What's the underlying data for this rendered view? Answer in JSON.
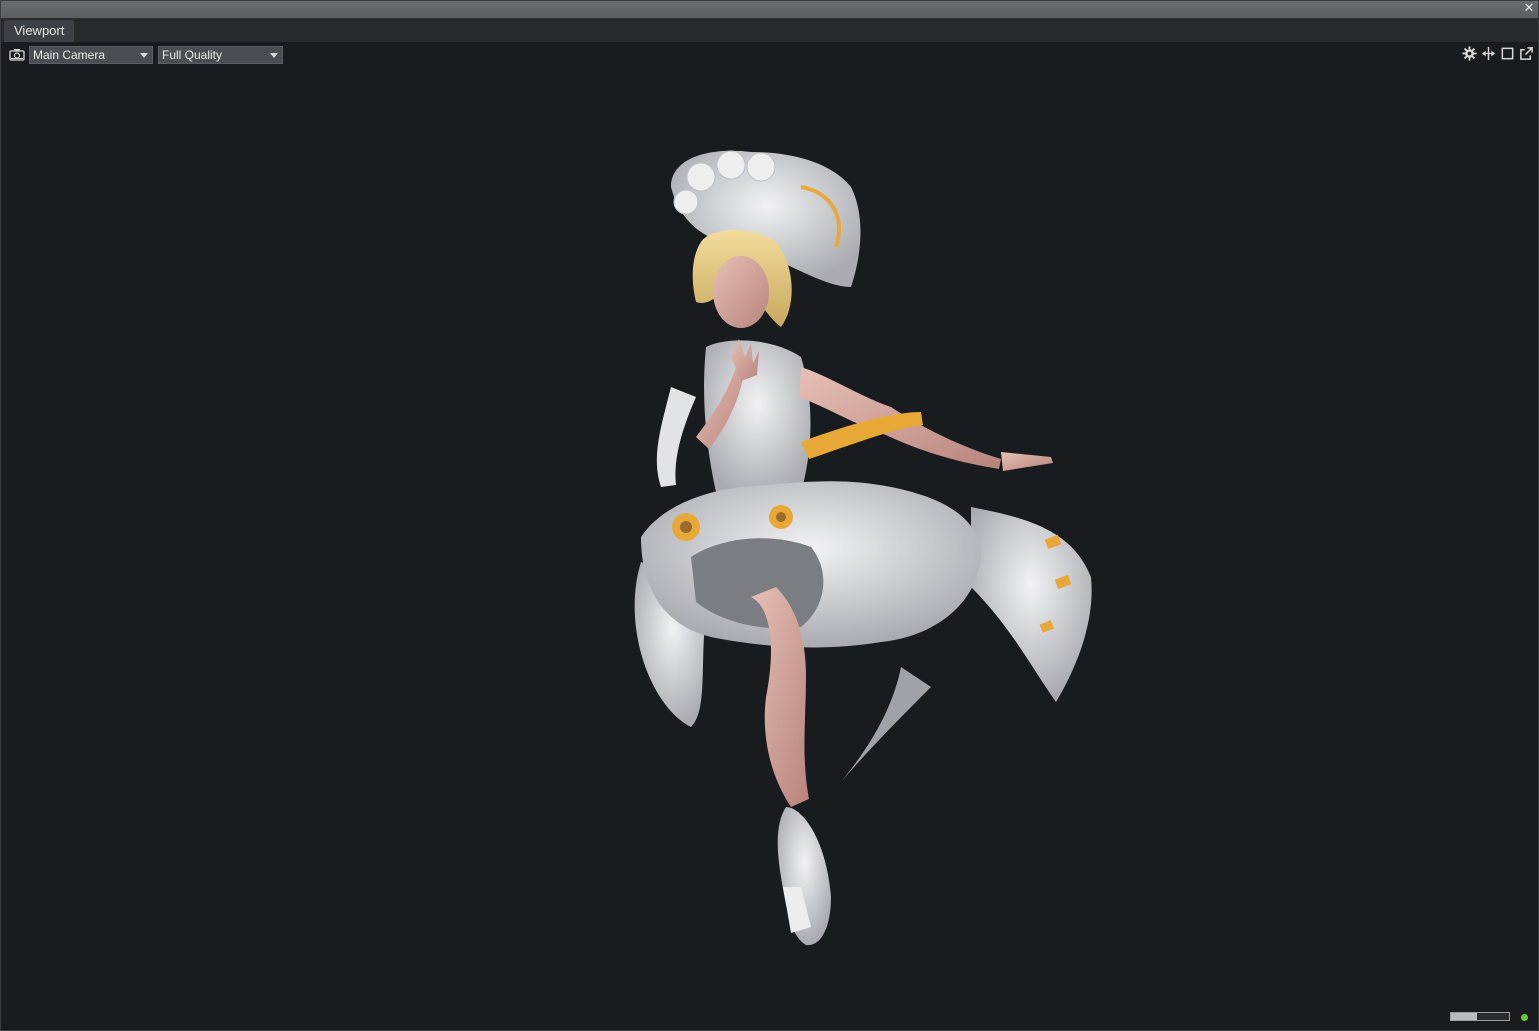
{
  "window": {
    "close_icon": "close-icon"
  },
  "tabs": [
    {
      "label": "Viewport",
      "active": true
    }
  ],
  "toolbar": {
    "camera_icon": "camera-icon",
    "camera_select": {
      "value": "Main Camera"
    },
    "quality_select": {
      "value": "Full Quality"
    },
    "right_icons": [
      "gear-icon",
      "split-icon",
      "maximize-icon",
      "popout-icon"
    ]
  },
  "scene": {
    "subject": "3d-character-render",
    "palette": {
      "background": "#191c1f",
      "cloth": "#e4e4e8",
      "accent": "#e8a838",
      "skin": "#d4a49a",
      "hair": "#e8d089"
    }
  },
  "status": {
    "progress_fraction": 0.45,
    "indicator_color": "#6cc43a"
  }
}
